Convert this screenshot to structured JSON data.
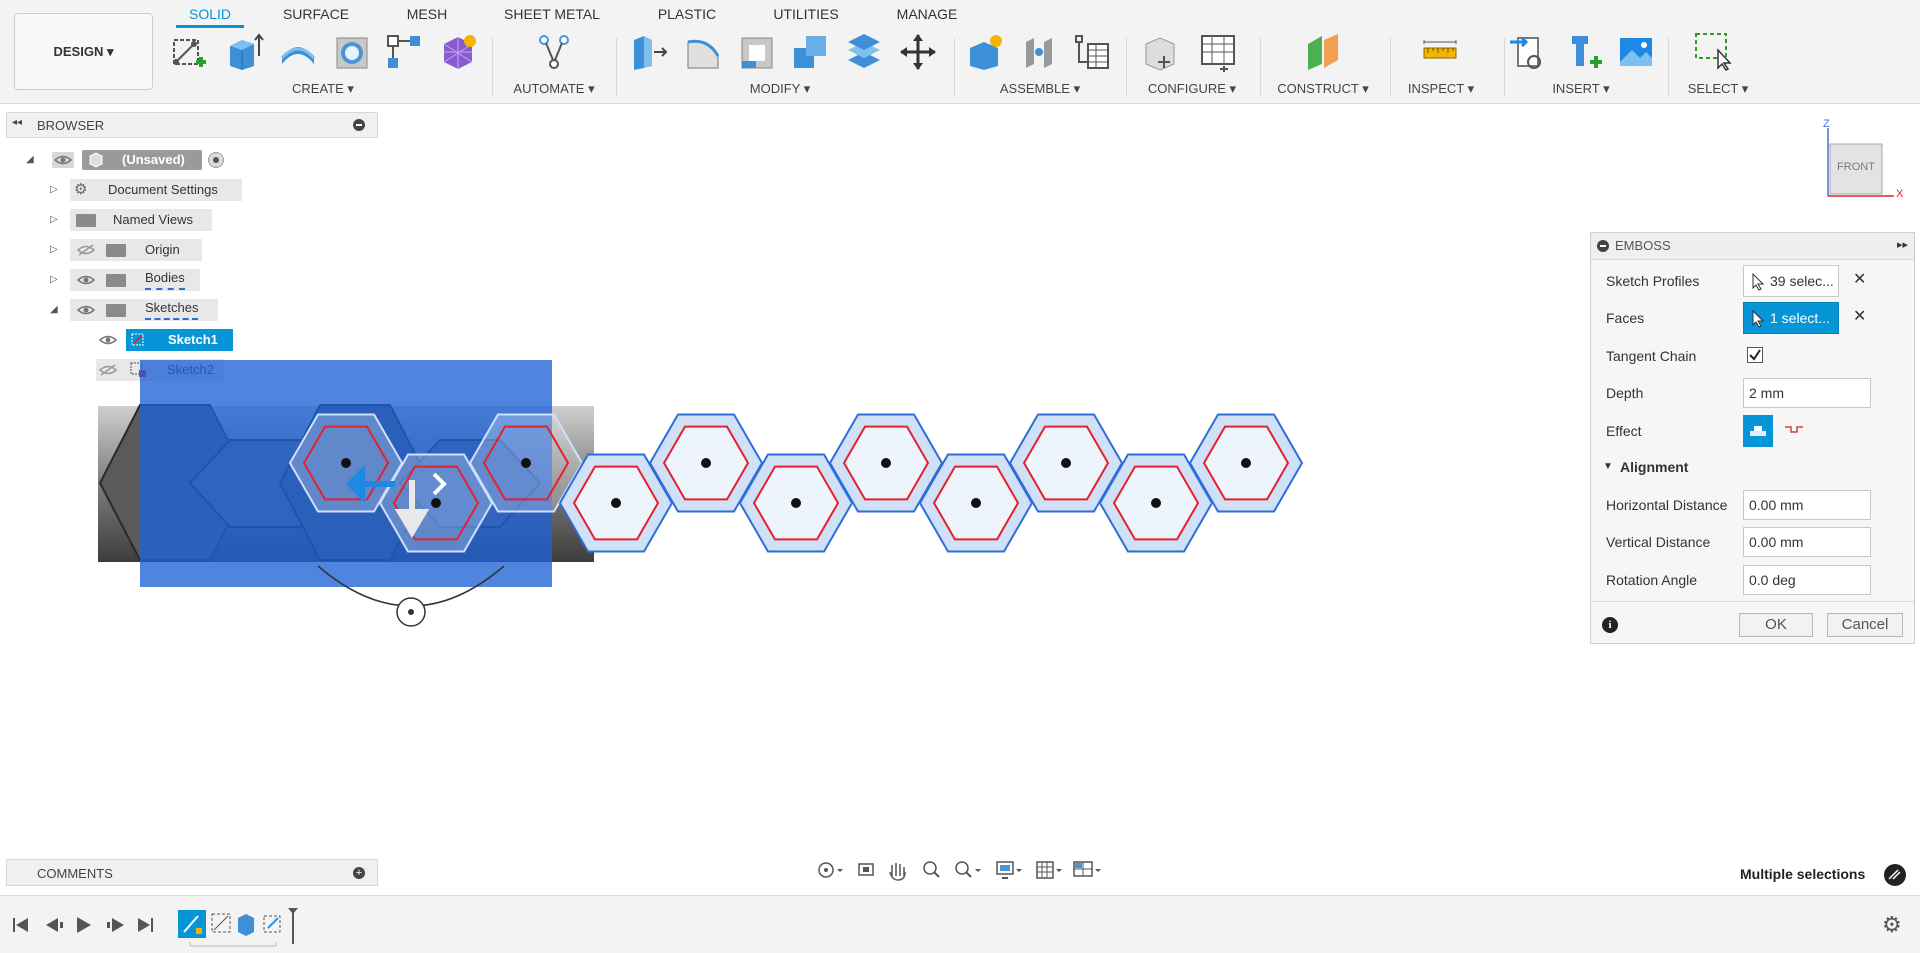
{
  "toolbar": {
    "workspace": "DESIGN",
    "tabs": [
      "SOLID",
      "SURFACE",
      "MESH",
      "SHEET METAL",
      "PLASTIC",
      "UTILITIES",
      "MANAGE"
    ],
    "active_tab": "SOLID",
    "groups": {
      "create": "CREATE",
      "automate": "AUTOMATE",
      "modify": "MODIFY",
      "assemble": "ASSEMBLE",
      "configure": "CONFIGURE",
      "construct": "CONSTRUCT",
      "inspect": "INSPECT",
      "insert": "INSERT",
      "select": "SELECT"
    },
    "dropdown_caret": "▾"
  },
  "browser": {
    "title": "BROWSER",
    "root": "(Unsaved)",
    "items": {
      "document_settings": "Document Settings",
      "named_views": "Named Views",
      "origin": "Origin",
      "bodies": "Bodies",
      "sketches": "Sketches",
      "sketch1": "Sketch1",
      "sketch2": "Sketch2"
    }
  },
  "viewcube": {
    "face": "FRONT",
    "z": "Z",
    "x": "X"
  },
  "emboss": {
    "title": "EMBOSS",
    "sketch_profiles_label": "Sketch Profiles",
    "sketch_profiles_value": "39 selec...",
    "faces_label": "Faces",
    "faces_value": "1 select...",
    "tangent_chain_label": "Tangent Chain",
    "tangent_chain_checked": true,
    "depth_label": "Depth",
    "depth_value": "2 mm",
    "effect_label": "Effect",
    "alignment_label": "Alignment",
    "horizontal_distance_label": "Horizontal Distance",
    "horizontal_distance_value": "0.00 mm",
    "vertical_distance_label": "Vertical Distance",
    "vertical_distance_value": "0.00 mm",
    "rotation_angle_label": "Rotation Angle",
    "rotation_angle_value": "0.0 deg",
    "ok": "OK",
    "cancel": "Cancel"
  },
  "comments": {
    "title": "COMMENTS"
  },
  "status": {
    "text": "Multiple selections"
  },
  "colors": {
    "accent": "#0696d7",
    "selection_blue": "#1f63d6",
    "profile_red": "#e5212b"
  }
}
